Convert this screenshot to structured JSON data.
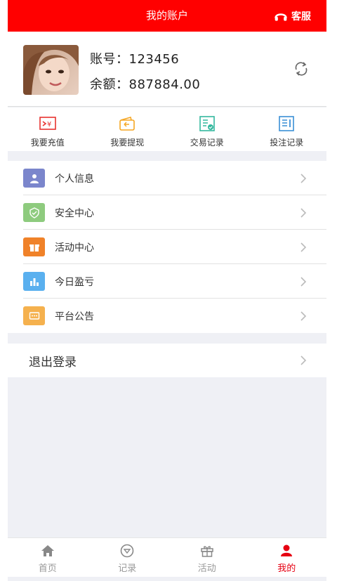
{
  "header": {
    "title": "我的账户",
    "service_label": "客服"
  },
  "profile": {
    "account_label": "账号：",
    "account_value": "123456",
    "balance_label": "余额：",
    "balance_value": "887884.00",
    "avatar_icon": "avatar-photo",
    "refresh_icon": "refresh-icon"
  },
  "quick_actions": [
    {
      "label": "我要充值",
      "icon": "recharge-icon",
      "color": "#e8322f"
    },
    {
      "label": "我要提现",
      "icon": "wallet-icon",
      "color": "#f5a623"
    },
    {
      "label": "交易记录",
      "icon": "transaction-icon",
      "color": "#34b89e"
    },
    {
      "label": "投注记录",
      "icon": "bet-record-icon",
      "color": "#3a8fd6"
    }
  ],
  "menu": [
    {
      "label": "个人信息",
      "icon": "person-icon",
      "color": "#7b86cc"
    },
    {
      "label": "安全中心",
      "icon": "shield-icon",
      "color": "#8ecb7e"
    },
    {
      "label": "活动中心",
      "icon": "gift-icon",
      "color": "#f08229"
    },
    {
      "label": "今日盈亏",
      "icon": "bar-chart-icon",
      "color": "#5ab0ef"
    },
    {
      "label": "平台公告",
      "icon": "message-icon",
      "color": "#f5b14e"
    }
  ],
  "logout": {
    "label": "退出登录"
  },
  "tabs": [
    {
      "label": "首页",
      "icon": "home-icon",
      "active": false
    },
    {
      "label": "记录",
      "icon": "record-icon",
      "active": false
    },
    {
      "label": "活动",
      "icon": "gift-icon",
      "active": false
    },
    {
      "label": "我的",
      "icon": "user-icon",
      "active": true
    }
  ],
  "colors": {
    "brand_red": "#ff0000",
    "active_tab": "#e60012",
    "background": "#eff0f5"
  }
}
